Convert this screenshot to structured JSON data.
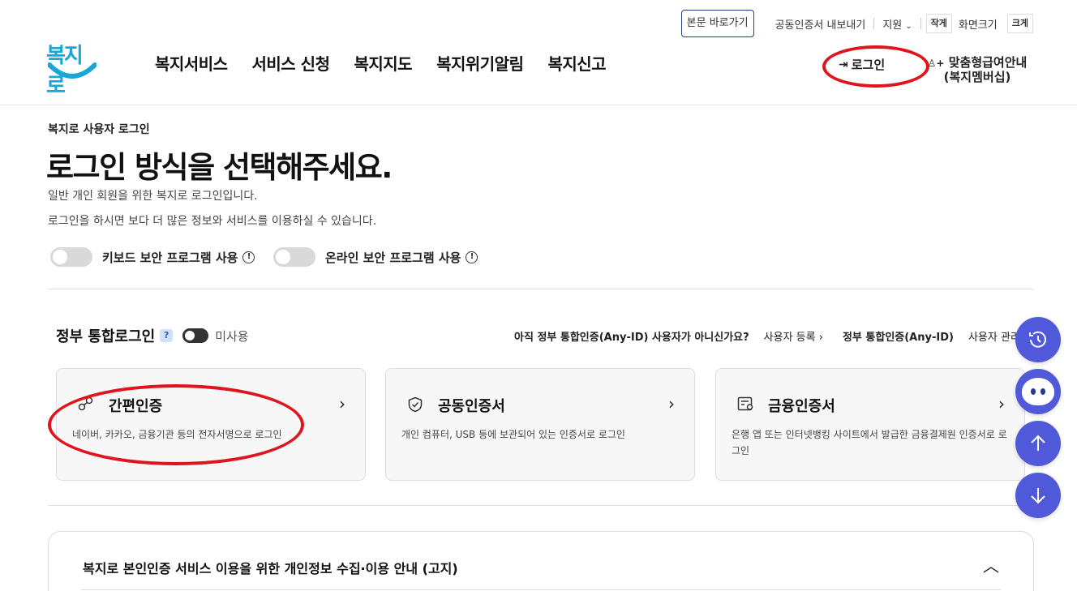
{
  "header": {
    "skip_link": "본문 바로가기",
    "util_links": [
      "공동인증서 내보내기",
      "지원"
    ],
    "size_small": "작게",
    "size_label": "화면크기",
    "size_large": "크게",
    "logo_text": "복지로",
    "nav": [
      "복지서비스",
      "서비스 신청",
      "복지지도",
      "복지위기알림",
      "복지신고"
    ],
    "login": "로그인",
    "member_line1": "맞춤형급여안내",
    "member_line2": "(복지멤버십)"
  },
  "page": {
    "breadcrumb": "복지로 사용자 로그인",
    "title": "로그인 방식을 선택해주세요.",
    "desc1": "일반 개인 회원을 위한 복지로 로그인입니다.",
    "desc2": "로그인을 하시면 보다 더 많은 정보와 서비스를 이용하실 수 있습니다.",
    "toggle_keyboard": "키보드 보안 프로그램 사용",
    "toggle_online": "온라인 보안 프로그램 사용"
  },
  "gov": {
    "title": "정부 통합로그인",
    "help": "?",
    "status": "미사용",
    "question": "아직 정부 통합인증(Any-ID) 사용자가 아니신가요?",
    "register": "사용자 등록",
    "anyid": "정부 통합인증(Any-ID)",
    "manage": "사용자 관리"
  },
  "cards": [
    {
      "title": "간편인증",
      "desc": "네이버, 카카오, 금융기관 등의 전자서명으로 로그인",
      "icon": "simple-auth-icon"
    },
    {
      "title": "공동인증서",
      "desc": "개인 컴퓨터, USB 등에 보관되어 있는 인증서로 로그인",
      "icon": "shield-check-icon"
    },
    {
      "title": "금융인증서",
      "desc": "은행 앱 또는 인터넷뱅킹 사이트에서 발급한 금융결제원 인증서로 로그인",
      "icon": "certificate-icon"
    }
  ],
  "notice": {
    "title": "복지로 본인인증 서비스 이용을 위한 개인정보 수집·이용 안내 (고지)"
  },
  "colors": {
    "fab": "#5059d9",
    "annotation": "#e0141e",
    "logo": "#1aa6d9"
  }
}
